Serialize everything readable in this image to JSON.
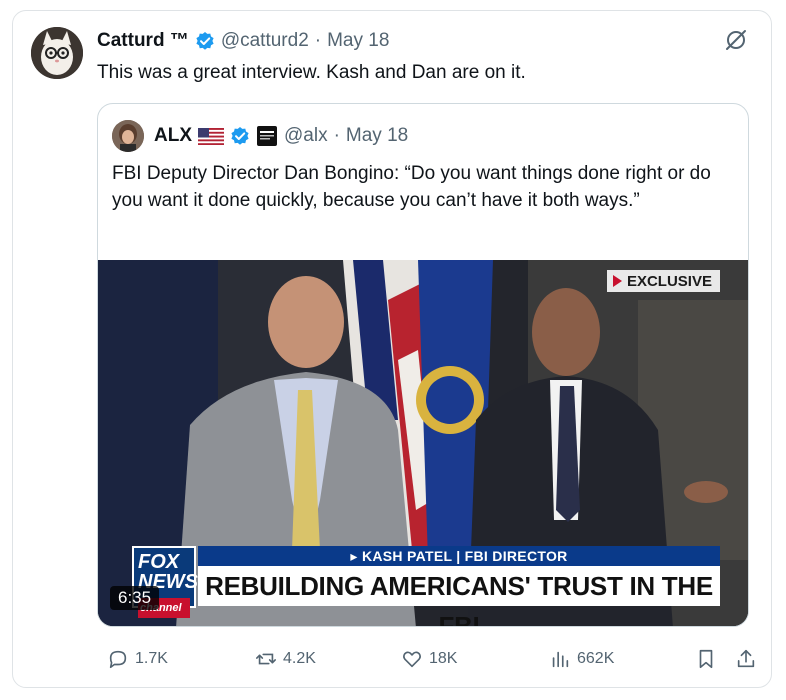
{
  "post": {
    "author": {
      "name": "Catturd ™",
      "handle": "@catturd2",
      "separator": "·",
      "date": "May 18"
    },
    "text": "This was a great interview. Kash and Dan are on it."
  },
  "quote": {
    "author": {
      "name": "ALX",
      "handle": "@alx",
      "separator": "·",
      "date": "May 18"
    },
    "text": "FBI Deputy Director Dan Bongino: “Do you want things done right or do you want it done quickly, because you can’t have it both ways.”",
    "video": {
      "badge": "EXCLUSIVE",
      "channel_logo": "FOX NEWS",
      "channel_sub": "channel",
      "name_strip": "▸ KASH PATEL | FBI DIRECTOR",
      "headline": "REBUILDING AMERICANS' TRUST IN THE FBI",
      "duration": "6:35"
    }
  },
  "actions": {
    "replies": "1.7K",
    "reposts": "4.2K",
    "likes": "18K",
    "views": "662K"
  },
  "icons": {
    "verified": "verified-badge-icon",
    "grok": "grok-icon",
    "flag": "us-flag-icon",
    "news": "news-affiliate-icon"
  },
  "colors": {
    "verified": "#1d9bf0",
    "muted": "#536471",
    "fox_blue": "#0a3a8a",
    "fox_red": "#c8102e"
  }
}
